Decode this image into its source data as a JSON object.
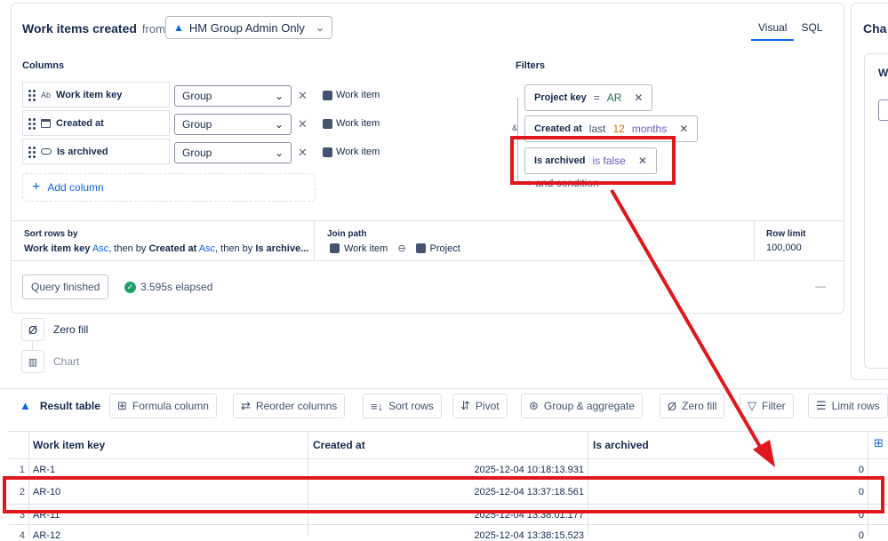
{
  "query": {
    "title": "Work items created",
    "from_label": "from",
    "source": "HM Group Admin Only",
    "tabs": [
      "Visual",
      "SQL"
    ]
  },
  "columns": {
    "heading": "Columns",
    "rows": [
      {
        "type_icon": "Ab",
        "name": "Work item key",
        "mode": "Group",
        "source": "Work item"
      },
      {
        "type_icon": "calendar-icon",
        "name": "Created at",
        "mode": "Group",
        "source": "Work item"
      },
      {
        "type_icon": "toggle-icon",
        "name": "Is archived",
        "mode": "Group",
        "source": "Work item"
      }
    ],
    "add_label": "Add column"
  },
  "filters": {
    "heading": "Filters",
    "conjunction": "&",
    "items": [
      {
        "key": "Project key",
        "op": "=",
        "value": "AR"
      },
      {
        "key": "Created at",
        "op": "last",
        "num": "12",
        "unit": "months"
      },
      {
        "key": "Is archived",
        "op": "is false"
      }
    ],
    "add_label": "+ and condition"
  },
  "sort": {
    "heading": "Sort rows by",
    "parts": [
      {
        "col": "Work item key",
        "dir": "Asc"
      },
      {
        "col": "Created at",
        "dir": "Asc"
      },
      {
        "col": "Is archive..."
      }
    ],
    "then_by": ", then by "
  },
  "join": {
    "heading": "Join path",
    "from": "Work item",
    "to": "Project"
  },
  "limit": {
    "heading": "Row limit",
    "value": "100,000"
  },
  "status": {
    "button": "Query finished",
    "elapsed": "3.595s elapsed",
    "collapse": "—"
  },
  "steps": [
    {
      "label": "Zero fill"
    },
    {
      "label": "Chart"
    }
  ],
  "right_panel": {
    "title": "Cha",
    "sub": "W"
  },
  "toolbar": {
    "result_table": "Result table",
    "items": [
      "Formula column",
      "Reorder columns",
      "Sort rows",
      "Pivot",
      "Group & aggregate",
      "Zero fill",
      "Filter",
      "Limit rows"
    ]
  },
  "table": {
    "headers": [
      "Work item key",
      "Created at",
      "Is archived"
    ],
    "rows": [
      {
        "n": "1",
        "key": "AR-1",
        "created": "2025-12-04 10:18:13.931",
        "archived": "0"
      },
      {
        "n": "2",
        "key": "AR-10",
        "created": "2025-12-04 13:37:18.561",
        "archived": "0"
      },
      {
        "n": "3",
        "key": "AR-11",
        "created": "2025-12-04 13:38:01.177",
        "archived": "0"
      },
      {
        "n": "4",
        "key": "AR-12",
        "created": "2025-12-04 13:38:15.523",
        "archived": "0"
      }
    ]
  },
  "colors": {
    "annotation_red": "#e0171c",
    "accent_blue": "#0c66e4",
    "success_green": "#22a06b"
  }
}
